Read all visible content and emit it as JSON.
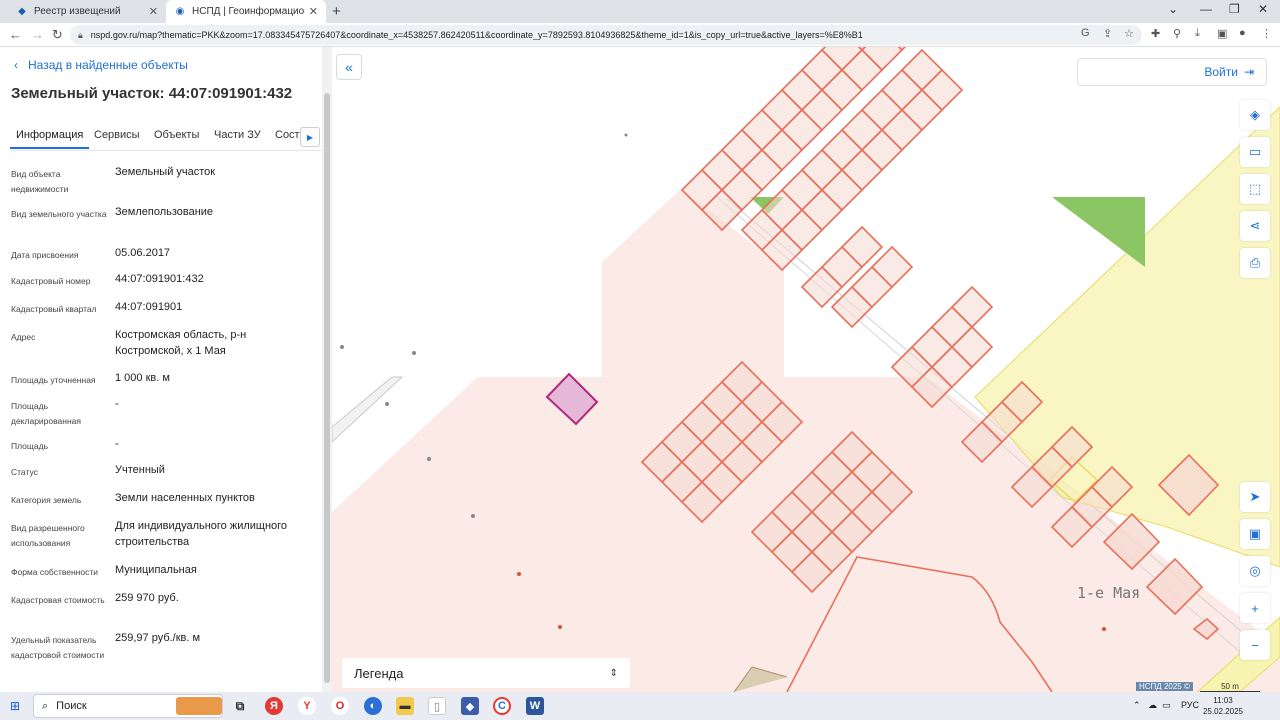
{
  "browser": {
    "tabs": [
      {
        "label": "Реестр извещений",
        "active": false,
        "icon": "registry-icon"
      },
      {
        "label": "НСПД | Геоинформационный п",
        "active": true,
        "icon": "nspd-icon"
      }
    ],
    "url": "nspd.gov.ru/map?thematic=PKK&zoom=17.083345475726407&coordinate_x=4538257.862420511&coordinate_y=7892593.8104936825&theme_id=1&is_copy_url=true&active_layers=%E8%B1"
  },
  "panel": {
    "back_label": "Назад в найденные объекты",
    "title": "Земельный участок: 44:07:091901:432",
    "tabs": [
      "Информация",
      "Сервисы",
      "Объекты",
      "Части ЗУ",
      "Соста"
    ],
    "fields": [
      {
        "label": "Вид объекта недвижимости",
        "value": "Земельный участок"
      },
      {
        "label": "Вид земельного участка",
        "value": "Землепользование"
      },
      {
        "label": "Дата присвоения",
        "value": "05.06.2017"
      },
      {
        "label": "Кадастровый номер",
        "value": "44:07:091901:432"
      },
      {
        "label": "Кадастровый квартал",
        "value": "44:07:091901"
      },
      {
        "label": "Адрес",
        "value": "Костромская область, р-н Костромской, х 1 Мая"
      },
      {
        "label": "Площадь уточненная",
        "value": "1 000 кв. м"
      },
      {
        "label": "Площадь декларированная",
        "value": "-"
      },
      {
        "label": "Площадь",
        "value": "-"
      },
      {
        "label": "Статус",
        "value": "Учтенный"
      },
      {
        "label": "Категория земель",
        "value": "Земли населенных пунктов"
      },
      {
        "label": "Вид разрешенного использования",
        "value": "Для индивидуального жилищного строительства"
      },
      {
        "label": "Форма собственности",
        "value": "Муниципальная"
      },
      {
        "label": "Кадастровая стоимость",
        "value": "259 970 руб."
      },
      {
        "label": "Удельный показатель кадастровой стоимости",
        "value": "259,97 руб./кв. м"
      }
    ]
  },
  "map": {
    "login_label": "Войти",
    "legend_label": "Легенда",
    "street_label": "1-е Мая",
    "attribution": "НСПД 2025 ©",
    "scale_label": "50 m",
    "tools": [
      "layers-icon",
      "ruler-icon",
      "select-area-icon",
      "share-icon",
      "print-icon",
      "locate-icon",
      "minimap-icon",
      "geolocation-icon",
      "zoom-in-icon",
      "zoom-out-icon"
    ],
    "colors": {
      "parcel_stroke": "#e8705a",
      "parcel_fill": "#f6d9d2",
      "selected_fill": "#e6b8d8",
      "selected_stroke": "#b0287e",
      "green": "#8cc564",
      "yellow": "#f5f1a8"
    }
  },
  "taskbar": {
    "search_label": "Поиск",
    "language": "РУС",
    "time": "11:03",
    "date": "25.02.2025"
  }
}
